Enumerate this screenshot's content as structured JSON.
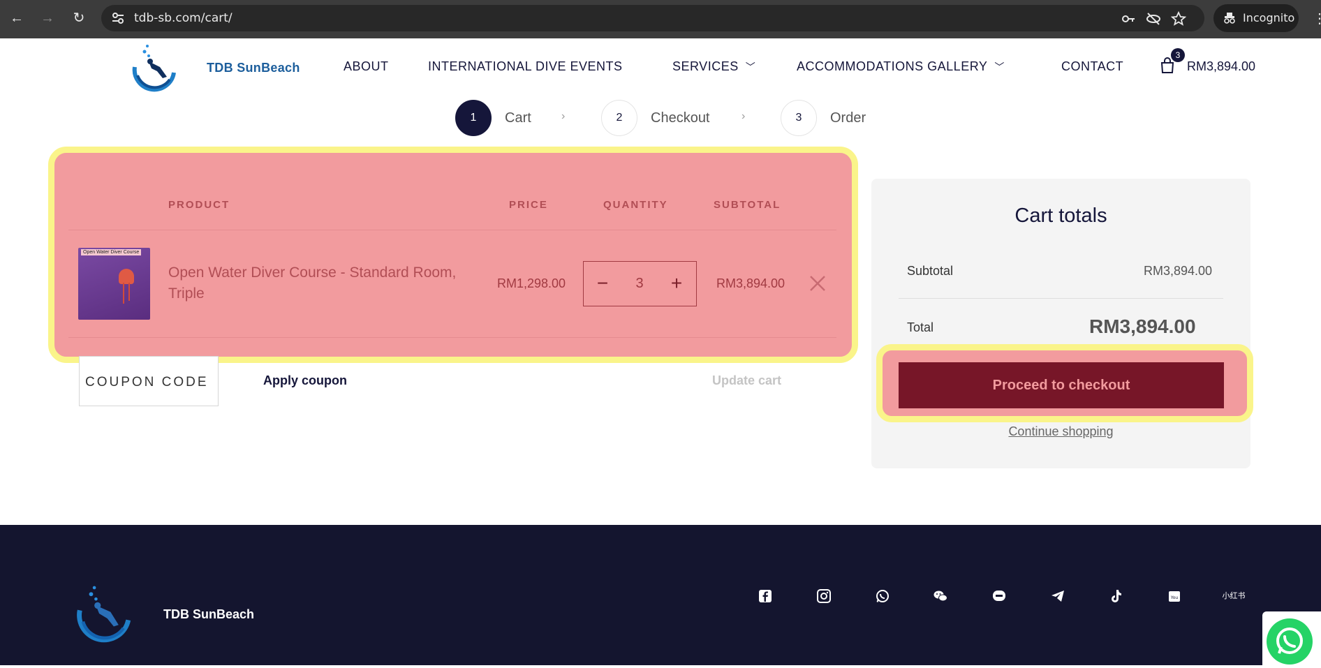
{
  "browser": {
    "url": "tdb-sb.com/cart/",
    "incognito_label": "Incognito"
  },
  "site": {
    "brand": "TDB SunBeach",
    "nav": [
      {
        "label": "ABOUT",
        "has_dropdown": false
      },
      {
        "label": "INTERNATIONAL DIVE EVENTS",
        "has_dropdown": false
      },
      {
        "label": "SERVICES",
        "has_dropdown": true
      },
      {
        "label": "ACCOMMODATIONS GALLERY",
        "has_dropdown": true
      },
      {
        "label": "CONTACT",
        "has_dropdown": false
      }
    ],
    "cart_count": "3",
    "cart_total": "RM3,894.00"
  },
  "steps": [
    {
      "num": "1",
      "label": "Cart",
      "active": true
    },
    {
      "num": "2",
      "label": "Checkout",
      "active": false
    },
    {
      "num": "3",
      "label": "Order",
      "active": false
    }
  ],
  "cart_table": {
    "headers": {
      "product": "PRODUCT",
      "price": "PRICE",
      "quantity": "QUANTITY",
      "subtotal": "SUBTOTAL"
    },
    "items": [
      {
        "thumb_caption": "Open Water Diver Course",
        "name": "Open Water Diver Course - Standard Room, Triple",
        "price": "RM1,298.00",
        "quantity": "3",
        "subtotal": "RM3,894.00"
      }
    ],
    "coupon_placeholder": "COUPON CODE",
    "apply_label": "Apply coupon",
    "update_label": "Update cart"
  },
  "totals": {
    "title": "Cart totals",
    "subtotal_label": "Subtotal",
    "subtotal_value": "RM3,894.00",
    "total_label": "Total",
    "total_value": "RM3,894.00",
    "checkout_label": "Proceed to checkout",
    "continue_label": "Continue shopping"
  },
  "footer": {
    "brand": "TDB SunBeach",
    "social_icons": [
      "facebook-icon",
      "instagram-icon",
      "whatsapp-icon",
      "wechat-icon",
      "line-icon",
      "telegram-icon",
      "tiktok-icon",
      "youtube-icon",
      "xiaohongshu-icon"
    ],
    "xiaohongshu_text": "小红书"
  },
  "colors": {
    "navy": "#15163a",
    "highlight_fill": "#f29b9e",
    "highlight_border": "#faf48a",
    "checkout_button": "#771628"
  }
}
